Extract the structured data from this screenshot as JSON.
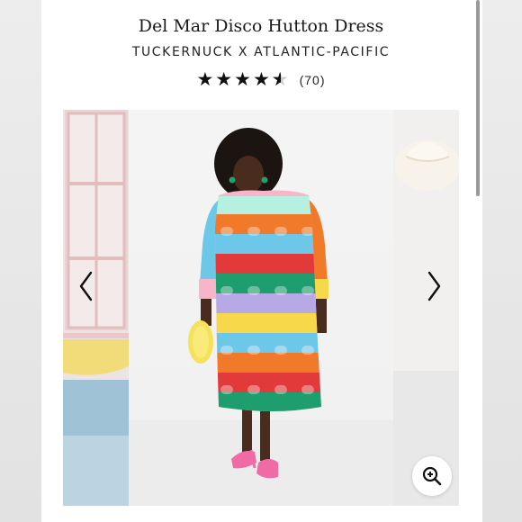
{
  "product": {
    "title": "Del Mar Disco Hutton Dress",
    "brand": "TUCKERNUCK X ATLANTIC-PACIFIC",
    "rating_stars": 4.5,
    "review_count": "(70)"
  },
  "gallery": {
    "prev_icon": "chevron-left-icon",
    "next_icon": "chevron-right-icon",
    "zoom_icon": "zoom-in-icon"
  },
  "colors": {
    "text": "#1a1a1a",
    "dress_teal": "#1e9e6e",
    "dress_orange": "#f07a2a",
    "dress_red": "#e23a3a",
    "dress_yellow": "#f7d84a",
    "dress_blue": "#6cc7e8",
    "dress_lilac": "#b6a9e6",
    "shoe_pink": "#f06aa6"
  }
}
